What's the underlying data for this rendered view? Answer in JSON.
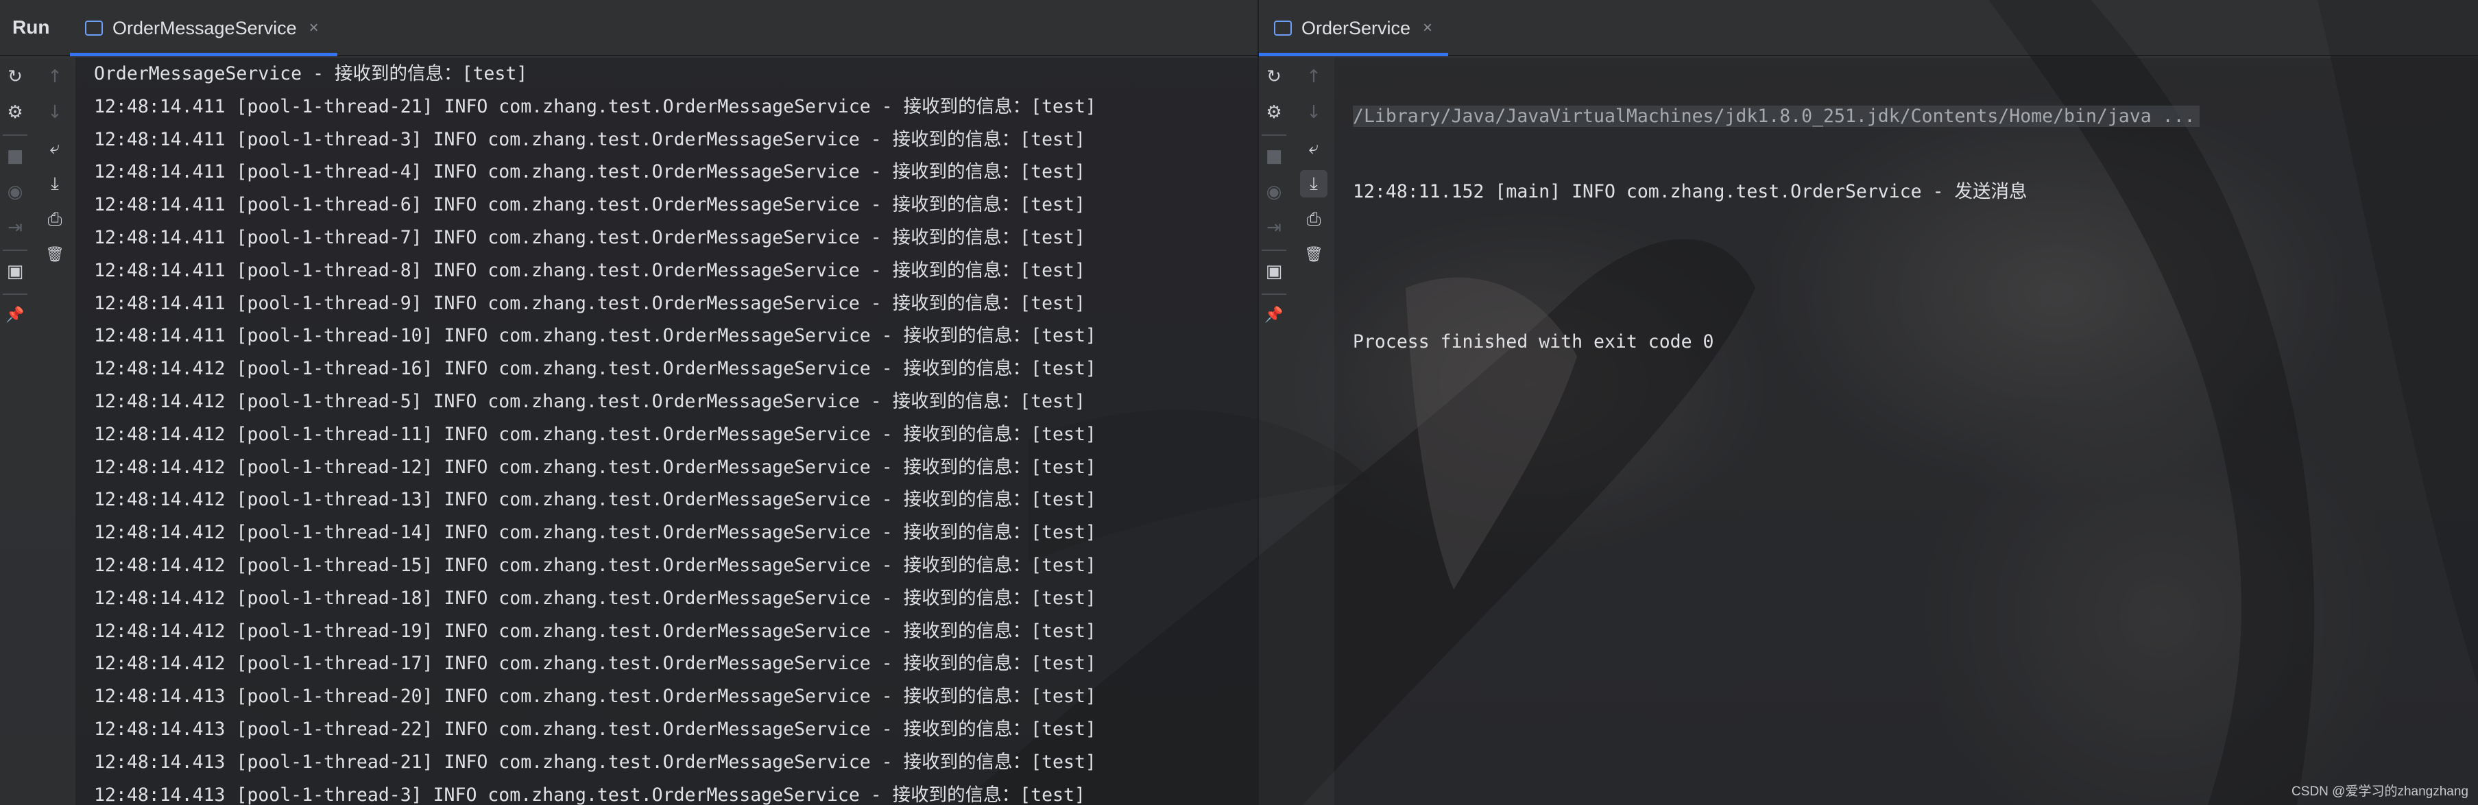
{
  "run_label": "Run",
  "left_pane": {
    "tab_title": "OrderMessageService",
    "close_glyph": "×",
    "lines": [
      "OrderMessageService - 接收到的信息：[test]",
      "12:48:14.411 [pool-1-thread-21] INFO com.zhang.test.OrderMessageService - 接收到的信息：[test]",
      "12:48:14.411 [pool-1-thread-3] INFO com.zhang.test.OrderMessageService - 接收到的信息：[test]",
      "12:48:14.411 [pool-1-thread-4] INFO com.zhang.test.OrderMessageService - 接收到的信息：[test]",
      "12:48:14.411 [pool-1-thread-6] INFO com.zhang.test.OrderMessageService - 接收到的信息：[test]",
      "12:48:14.411 [pool-1-thread-7] INFO com.zhang.test.OrderMessageService - 接收到的信息：[test]",
      "12:48:14.411 [pool-1-thread-8] INFO com.zhang.test.OrderMessageService - 接收到的信息：[test]",
      "12:48:14.411 [pool-1-thread-9] INFO com.zhang.test.OrderMessageService - 接收到的信息：[test]",
      "12:48:14.411 [pool-1-thread-10] INFO com.zhang.test.OrderMessageService - 接收到的信息：[test]",
      "12:48:14.412 [pool-1-thread-16] INFO com.zhang.test.OrderMessageService - 接收到的信息：[test]",
      "12:48:14.412 [pool-1-thread-5] INFO com.zhang.test.OrderMessageService - 接收到的信息：[test]",
      "12:48:14.412 [pool-1-thread-11] INFO com.zhang.test.OrderMessageService - 接收到的信息：[test]",
      "12:48:14.412 [pool-1-thread-12] INFO com.zhang.test.OrderMessageService - 接收到的信息：[test]",
      "12:48:14.412 [pool-1-thread-13] INFO com.zhang.test.OrderMessageService - 接收到的信息：[test]",
      "12:48:14.412 [pool-1-thread-14] INFO com.zhang.test.OrderMessageService - 接收到的信息：[test]",
      "12:48:14.412 [pool-1-thread-15] INFO com.zhang.test.OrderMessageService - 接收到的信息：[test]",
      "12:48:14.412 [pool-1-thread-18] INFO com.zhang.test.OrderMessageService - 接收到的信息：[test]",
      "12:48:14.412 [pool-1-thread-19] INFO com.zhang.test.OrderMessageService - 接收到的信息：[test]",
      "12:48:14.412 [pool-1-thread-17] INFO com.zhang.test.OrderMessageService - 接收到的信息：[test]",
      "12:48:14.413 [pool-1-thread-20] INFO com.zhang.test.OrderMessageService - 接收到的信息：[test]",
      "12:48:14.413 [pool-1-thread-22] INFO com.zhang.test.OrderMessageService - 接收到的信息：[test]",
      "12:48:14.413 [pool-1-thread-21] INFO com.zhang.test.OrderMessageService - 接收到的信息：[test]",
      "12:48:14.413 [pool-1-thread-3] INFO com.zhang.test.OrderMessageService - 接收到的信息：[test]"
    ]
  },
  "right_pane": {
    "tab_title": "OrderService",
    "close_glyph": "×",
    "command_line": "/Library/Java/JavaVirtualMachines/jdk1.8.0_251.jdk/Contents/Home/bin/java ...",
    "log_line": "12:48:11.152 [main] INFO com.zhang.test.OrderService - 发送消息",
    "exit_line": "Process finished with exit code 0"
  },
  "toolbar_icons": {
    "rerun": "↻",
    "settings": "⚙",
    "stop": "■",
    "up": "↑",
    "down": "↓",
    "soft_wrap": "⤶",
    "scroll_to_end": "⤓",
    "print": "⎙",
    "clear": "🗑",
    "camera": "◉",
    "exit": "⇥",
    "layout": "▣",
    "pin": "📌"
  },
  "colors": {
    "accent": "#3574f0",
    "text": "#dfe1e5",
    "muted": "#5c5f66"
  },
  "watermark": "CSDN @爱学习的zhangzhang"
}
